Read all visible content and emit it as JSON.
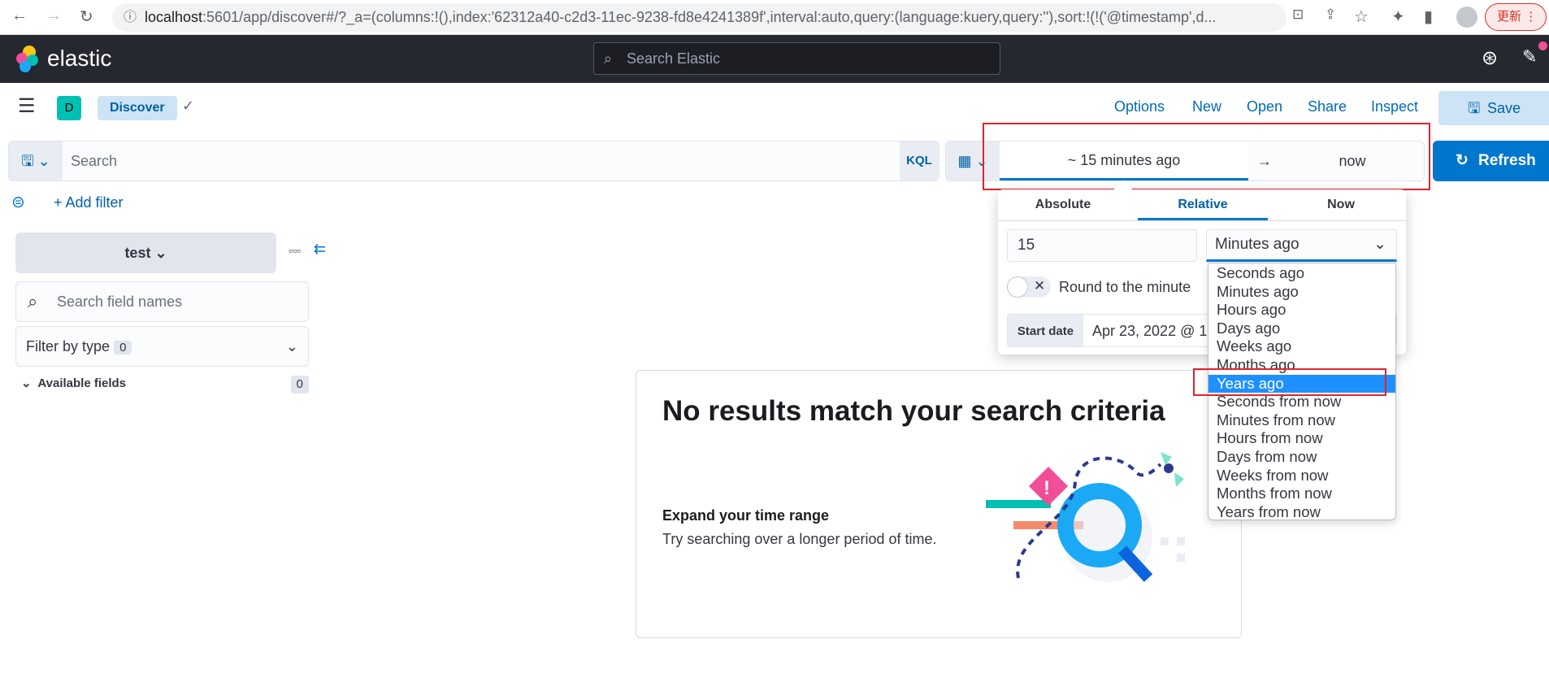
{
  "browser": {
    "url_host": "localhost",
    "url_rest": ":5601/app/discover#/?_a=(columns:!(),index:'62312a40-c2d3-11ec-9238-fd8e4241389f',interval:auto,query:(language:kuery,query:''),sort:!(!('@timestamp',d...",
    "update_label": "更新"
  },
  "header": {
    "brand": "elastic",
    "search_placeholder": "Search Elastic"
  },
  "nav": {
    "space_initial": "D",
    "app": "Discover",
    "links": [
      "Options",
      "New",
      "Open",
      "Share",
      "Inspect"
    ],
    "save": "Save"
  },
  "query": {
    "placeholder": "Search",
    "language": "KQL",
    "start": "~ 15 minutes ago",
    "arrow": "→",
    "end": "now",
    "refresh": "Refresh",
    "add_filter": "+ Add filter"
  },
  "sidebar": {
    "index_pattern": "test",
    "search_placeholder": "Search field names",
    "filter_by_type": "Filter by type",
    "filter_count": "0",
    "available_fields": "Available fields",
    "available_count": "0"
  },
  "empty": {
    "title": "No results match your search criteria",
    "subtitle": "Expand your time range",
    "text": "Try searching over a longer period of time."
  },
  "popover": {
    "tabs": [
      "Absolute",
      "Relative",
      "Now"
    ],
    "active_tab": "Relative",
    "value": "15",
    "unit": "Minutes ago",
    "round_label": "Round to the minute",
    "start_label": "Start date",
    "start_value": "Apr 23, 2022 @ 1",
    "options": [
      "Seconds ago",
      "Minutes ago",
      "Hours ago",
      "Days ago",
      "Weeks ago",
      "Months ago",
      "Years ago",
      "Seconds from now",
      "Minutes from now",
      "Hours from now",
      "Days from now",
      "Weeks from now",
      "Months from now",
      "Years from now"
    ],
    "highlighted": "Years ago"
  },
  "colors": {
    "accent": "#0077cc",
    "highlight": "#1e90ff",
    "annotation": "#e0242b"
  }
}
